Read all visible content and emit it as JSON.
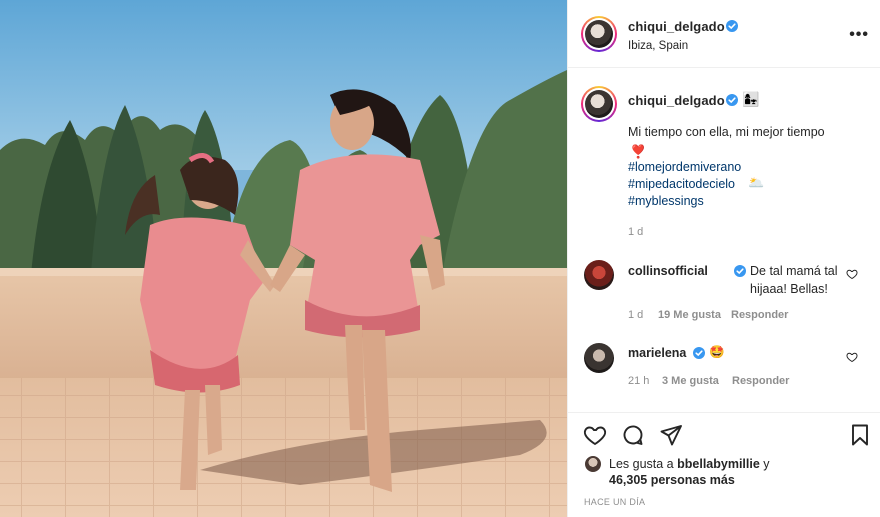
{
  "post": {
    "username": "chiqui_delgado",
    "location": "Ibiza, Spain",
    "more_icon": "more-options-icon",
    "more_label": "•••"
  },
  "caption": {
    "username": "chiqui_delgado",
    "emoji_after_name": "👩‍👧",
    "text": "Mi tiempo con ella, mi mejor tiempo",
    "emoji_heart": "❣️",
    "hashtags": [
      "#lomejordemiverano",
      "#mipedacitodecielo",
      "#myblessings"
    ],
    "hashtag2_emoji": "🌥️",
    "time": "1 d"
  },
  "comments": [
    {
      "username": "collinsofficial",
      "verified": true,
      "text": "De tal mamá tal hijaaa! Bellas!",
      "time": "1 d",
      "likes": "19 Me gusta",
      "reply": "Responder"
    },
    {
      "username": "marielena",
      "verified": true,
      "text": "🤩",
      "time": "21 h",
      "likes": "3 Me gusta",
      "reply": "Responder"
    }
  ],
  "likes": {
    "prefix": "Les gusta a",
    "user": "bbellabymillie",
    "joiner": "y",
    "count": "46,305 personas más"
  },
  "posted_ago": "HACE UN DÍA",
  "colors": {
    "text": "#262626",
    "muted": "#8e8e8e",
    "hashtag": "#00376b",
    "verified": "#3897f0",
    "border": "#efefef"
  }
}
